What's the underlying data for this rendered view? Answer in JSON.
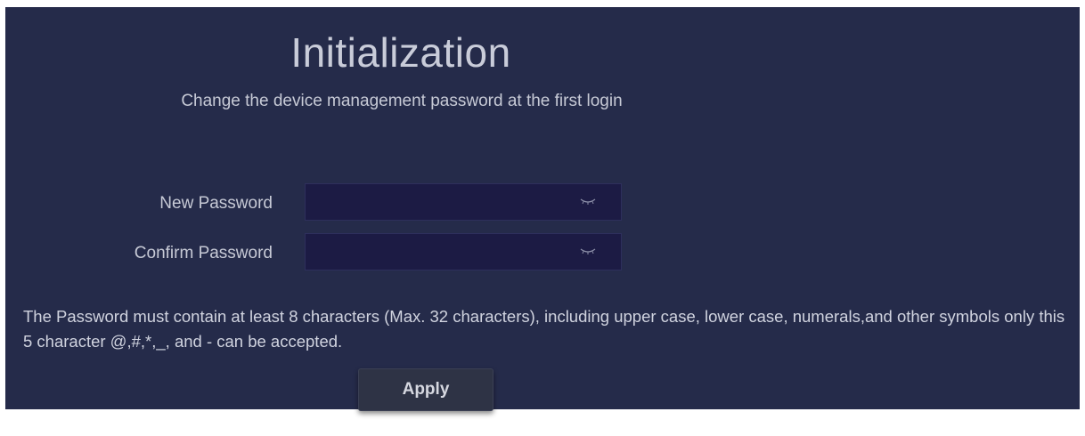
{
  "header": {
    "title": "Initialization",
    "subtitle": "Change the device management password at the first login"
  },
  "form": {
    "new_password": {
      "label": "New Password",
      "value": "",
      "icon": "eye-closed-icon"
    },
    "confirm_password": {
      "label": "Confirm Password",
      "value": "",
      "icon": "eye-closed-icon"
    },
    "hint": "The Password must contain at least 8 characters (Max. 32 characters), including upper case, lower case, numerals,and other symbols only this 5 character @,#,*,_, and - can be accepted.",
    "apply_label": "Apply"
  },
  "colors": {
    "panel_background": "#252b4a",
    "input_background": "#1c1b44",
    "button_background": "#2e3345"
  }
}
